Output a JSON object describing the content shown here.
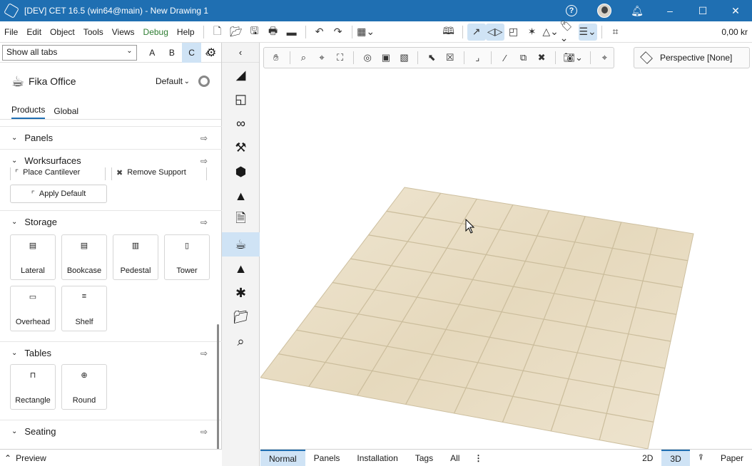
{
  "window": {
    "title": "[DEV] CET 16.5 (win64@main) - New Drawing 1",
    "controls": {
      "help": "?",
      "minimize": "–",
      "maximize": "☐",
      "close": "✕"
    }
  },
  "menu": {
    "items": [
      "File",
      "Edit",
      "Object",
      "Tools",
      "Views",
      "Debug",
      "Help"
    ],
    "price": "0,00 kr"
  },
  "left_panel": {
    "tab_select": "Show all tabs",
    "letters": [
      "A",
      "B",
      "C"
    ],
    "active_letter": "C",
    "catalog_name": "Fika Office",
    "variant": "Default",
    "subtabs": [
      "Products",
      "Global"
    ],
    "active_subtab": "Products",
    "sections": {
      "panels": "Panels",
      "worksurfaces": "Worksurfaces",
      "storage": "Storage",
      "tables": "Tables",
      "seating": "Seating"
    },
    "worksurface_buttons": {
      "place_cantilever": "Place Cantilever",
      "remove_support": "Remove Support",
      "apply_default": "Apply Default"
    },
    "storage_items": [
      "Lateral",
      "Bookcase",
      "Pedestal",
      "Tower",
      "Overhead",
      "Shelf"
    ],
    "table_items": [
      "Rectangle",
      "Round"
    ],
    "preview_label": "Preview"
  },
  "viewport": {
    "perspective_label": "Perspective [None]",
    "camera_mode": "3D"
  },
  "bottom": {
    "tabs": [
      "Normal",
      "Panels",
      "Installation",
      "Tags",
      "All"
    ],
    "active_tab": "Normal",
    "view_2d": "2D",
    "view_3d": "3D",
    "paper": "Paper"
  },
  "colors": {
    "titlebar": "#1f6fb2",
    "accent": "#cfe3f5",
    "floor": "#e8dcc4"
  }
}
